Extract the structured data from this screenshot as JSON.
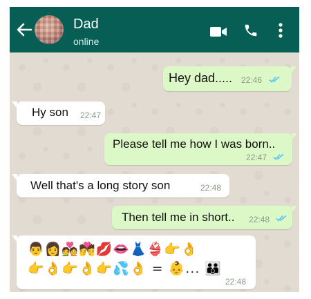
{
  "header": {
    "contact_name": "Dad",
    "status": "online",
    "back_icon": "arrow-left-icon",
    "video_icon": "video-call-icon",
    "call_icon": "phone-icon",
    "menu_icon": "more-vertical-icon",
    "bar_color": "#075e54"
  },
  "chat": {
    "background_color": "#e2dbd1",
    "outgoing_color": "#dcf8c6",
    "incoming_color": "#ffffff",
    "tick_color": "#4fc3f7",
    "messages": [
      {
        "direction": "outgoing",
        "text": "Hey dad.....",
        "time": "22:46",
        "ticks": "read"
      },
      {
        "direction": "incoming",
        "text": "Hy son",
        "time": "22:47"
      },
      {
        "direction": "outgoing",
        "text": "Please tell me how I was born..",
        "time": "22:47",
        "ticks": "read"
      },
      {
        "direction": "incoming",
        "text": "Well that's a long story son",
        "time": "22:48"
      },
      {
        "direction": "outgoing",
        "text": "Then tell me in short..",
        "time": "22:48",
        "ticks": "read"
      },
      {
        "direction": "incoming",
        "emoji_row1": "👨👩💑💏💋👄👗👙👉👌",
        "emoji_row2": "👉👌👉👌👉💦👌 = 👶... 👪",
        "time": "22:48"
      }
    ]
  }
}
